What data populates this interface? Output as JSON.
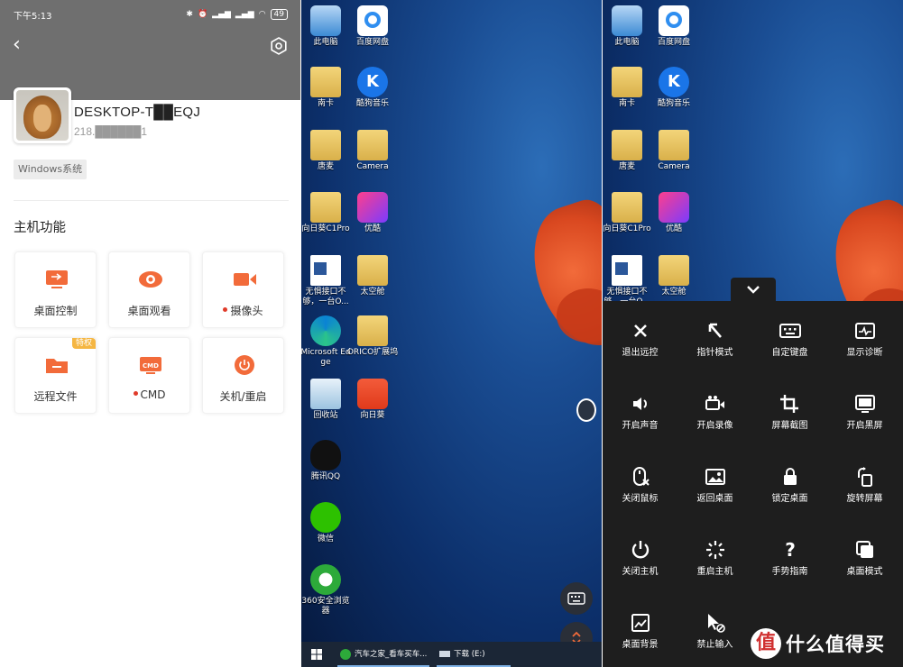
{
  "status_bar": {
    "time": "下午5:13",
    "battery": "49"
  },
  "host": {
    "name": "DESKTOP-T██EQJ",
    "ip": "218.██████1",
    "os_tag": "Windows系统"
  },
  "section_title": "主机功能",
  "functions": [
    {
      "label": "桌面控制",
      "icon": "desktop-control-icon",
      "dot": false,
      "badge": ""
    },
    {
      "label": "桌面观看",
      "icon": "eye-icon",
      "dot": false,
      "badge": ""
    },
    {
      "label": "摄像头",
      "icon": "camera-icon",
      "dot": true,
      "badge": ""
    },
    {
      "label": "远程文件",
      "icon": "folder-icon",
      "dot": false,
      "badge": "特权"
    },
    {
      "label": "CMD",
      "icon": "cmd-icon",
      "dot": true,
      "badge": ""
    },
    {
      "label": "关机/重启",
      "icon": "power-icon",
      "dot": false,
      "badge": ""
    }
  ],
  "desktop_icons": {
    "col1": [
      "此电脑",
      "南卡",
      "唐麦",
      "向日葵C1Pro",
      "无惧接口不够，一台O...",
      "Microsoft Edge",
      "回收站",
      "腾讯QQ",
      "微信",
      "360安全浏览器"
    ],
    "col2": [
      "百度网盘",
      "酷狗音乐",
      "Camera",
      "优酷",
      "太空舱",
      "ORICO扩展坞",
      "向日葵"
    ]
  },
  "taskbar": {
    "item1": "汽车之家_看车买车...",
    "item2": "下载 (E:)"
  },
  "control_menu": [
    {
      "label": "退出远控",
      "icon": "close-icon"
    },
    {
      "label": "指针模式",
      "icon": "pointer-icon"
    },
    {
      "label": "自定键盘",
      "icon": "keyboard-icon"
    },
    {
      "label": "显示诊断",
      "icon": "diagnostic-icon"
    },
    {
      "label": "开启声音",
      "icon": "speaker-icon"
    },
    {
      "label": "开启录像",
      "icon": "video-record-icon"
    },
    {
      "label": "屏幕截图",
      "icon": "crop-icon"
    },
    {
      "label": "开启黑屏",
      "icon": "black-screen-icon"
    },
    {
      "label": "关闭鼠标",
      "icon": "mouse-off-icon"
    },
    {
      "label": "返回桌面",
      "icon": "image-icon"
    },
    {
      "label": "锁定桌面",
      "icon": "lock-icon"
    },
    {
      "label": "旋转屏幕",
      "icon": "rotate-icon"
    },
    {
      "label": "关闭主机",
      "icon": "power-icon"
    },
    {
      "label": "重启主机",
      "icon": "restart-icon"
    },
    {
      "label": "手势指南",
      "icon": "help-icon"
    },
    {
      "label": "桌面模式",
      "icon": "desktop-mode-icon"
    },
    {
      "label": "桌面背景",
      "icon": "wallpaper-icon"
    },
    {
      "label": "禁止输入",
      "icon": "block-input-icon"
    }
  ],
  "watermark": {
    "logo": "值",
    "text": "什么值得买"
  },
  "colors": {
    "accent": "#f26b3a",
    "overlay_bg": "#1e1e1e",
    "header_gray": "#6f6f6f"
  }
}
